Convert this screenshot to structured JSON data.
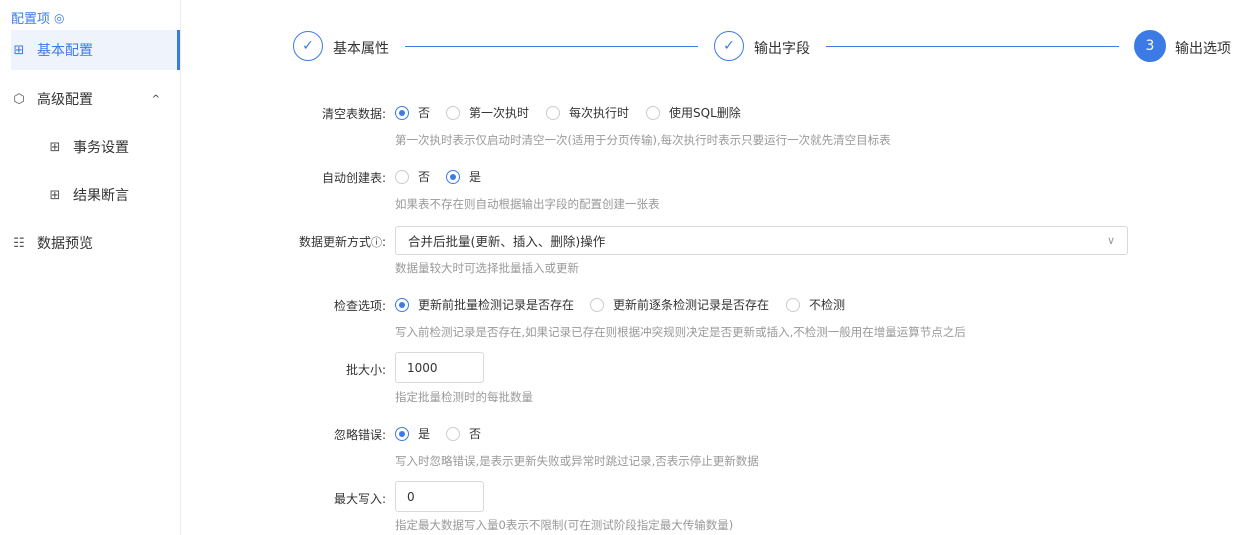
{
  "sidebar": {
    "title": "配置项",
    "items": [
      {
        "label": "基本配置"
      },
      {
        "label": "高级配置"
      },
      {
        "label": "事务设置"
      },
      {
        "label": "结果断言"
      },
      {
        "label": "数据预览"
      }
    ]
  },
  "steps": [
    {
      "label": "基本属性",
      "number": "✓"
    },
    {
      "label": "输出字段",
      "number": "✓"
    },
    {
      "label": "输出选项",
      "number": "3"
    }
  ],
  "form": {
    "clear_table": {
      "label": "清空表数据:",
      "options": [
        "否",
        "第一次执时",
        "每次执行时",
        "使用SQL删除"
      ],
      "selected": "否",
      "hint": "第一次执时表示仅启动时清空一次(适用于分页传输),每次执行时表示只要运行一次就先清空目标表"
    },
    "auto_create": {
      "label": "自动创建表:",
      "options": [
        "否",
        "是"
      ],
      "selected": "是",
      "hint": "如果表不存在则自动根据输出字段的配置创建一张表"
    },
    "update_mode": {
      "label": "数据更新方式",
      "value": "合并后批量(更新、插入、删除)操作",
      "hint": "数据量较大时可选择批量插入或更新"
    },
    "check_option": {
      "label": "检查选项:",
      "options": [
        "更新前批量检测记录是否存在",
        "更新前逐条检测记录是否存在",
        "不检测"
      ],
      "selected": "更新前批量检测记录是否存在",
      "hint": "写入前检测记录是否存在,如果记录已存在则根据冲突规则决定是否更新或插入,不检测一般用在增量运算节点之后"
    },
    "batch_size": {
      "label": "批大小:",
      "value": "1000",
      "hint": "指定批量检测时的每批数量"
    },
    "ignore_errors": {
      "label": "忽略错误:",
      "options": [
        "是",
        "否"
      ],
      "selected": "是",
      "hint": "写入时忽略错误,是表示更新失败或异常时跳过记录,否表示停止更新数据"
    },
    "max_write": {
      "label": "最大写入:",
      "value": "0",
      "hint": "指定最大数据写入量0表示不限制(可在测试阶段指定最大传输数量)"
    }
  }
}
